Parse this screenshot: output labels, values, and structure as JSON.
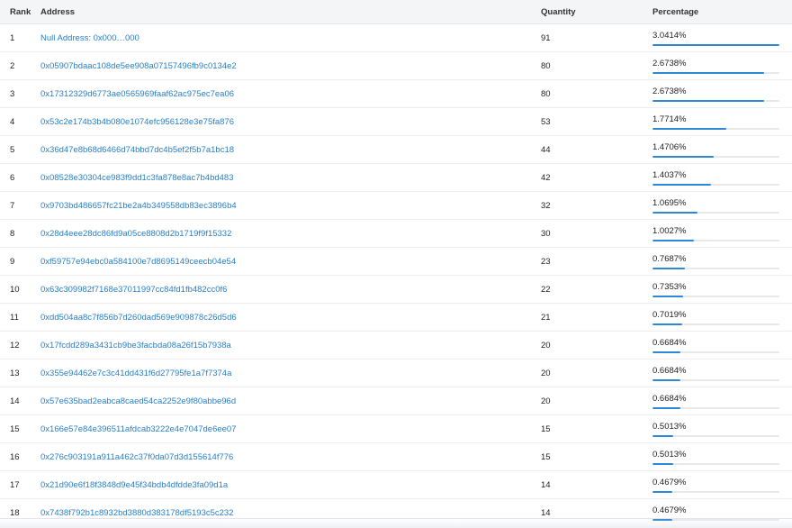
{
  "table": {
    "headers": {
      "rank": "Rank",
      "address": "Address",
      "quantity": "Quantity",
      "percentage": "Percentage"
    },
    "rows": [
      {
        "rank": "1",
        "address": "Null Address: 0x000…000",
        "quantity": "91",
        "percentage": "3.0414%",
        "percentage_value": 3.0414
      },
      {
        "rank": "2",
        "address": "0x05907bdaac108de5ee908a07157496fb9c0134e2",
        "quantity": "80",
        "percentage": "2.6738%",
        "percentage_value": 2.6738
      },
      {
        "rank": "3",
        "address": "0x17312329d6773ae0565969faaf62ac975ec7ea06",
        "quantity": "80",
        "percentage": "2.6738%",
        "percentage_value": 2.6738
      },
      {
        "rank": "4",
        "address": "0x53c2e174b3b4b080e1074efc956128e3e75fa876",
        "quantity": "53",
        "percentage": "1.7714%",
        "percentage_value": 1.7714
      },
      {
        "rank": "5",
        "address": "0x36d47e8b68d6466d74bbd7dc4b5ef2f5b7a1bc18",
        "quantity": "44",
        "percentage": "1.4706%",
        "percentage_value": 1.4706
      },
      {
        "rank": "6",
        "address": "0x08528e30304ce983f9dd1c3fa878e8ac7b4bd483",
        "quantity": "42",
        "percentage": "1.4037%",
        "percentage_value": 1.4037
      },
      {
        "rank": "7",
        "address": "0x9703bd486657fc21be2a4b349558db83ec3896b4",
        "quantity": "32",
        "percentage": "1.0695%",
        "percentage_value": 1.0695
      },
      {
        "rank": "8",
        "address": "0x28d4eee28dc86fd9a05ce8808d2b1719f9f15332",
        "quantity": "30",
        "percentage": "1.0027%",
        "percentage_value": 1.0027
      },
      {
        "rank": "9",
        "address": "0xf59757e94ebc0a584100e7d8695149ceecb04e54",
        "quantity": "23",
        "percentage": "0.7687%",
        "percentage_value": 0.7687
      },
      {
        "rank": "10",
        "address": "0x63c309982f7168e37011997cc84fd1fb482cc0f6",
        "quantity": "22",
        "percentage": "0.7353%",
        "percentage_value": 0.7353
      },
      {
        "rank": "11",
        "address": "0xdd504aa8c7f856b7d260dad569e909878c26d5d6",
        "quantity": "21",
        "percentage": "0.7019%",
        "percentage_value": 0.7019
      },
      {
        "rank": "12",
        "address": "0x17fcdd289a3431cb9be3facbda08a26f15b7938a",
        "quantity": "20",
        "percentage": "0.6684%",
        "percentage_value": 0.6684
      },
      {
        "rank": "13",
        "address": "0x355e94462e7c3c41dd431f6d27795fe1a7f7374a",
        "quantity": "20",
        "percentage": "0.6684%",
        "percentage_value": 0.6684
      },
      {
        "rank": "14",
        "address": "0x57e635bad2eabca8caed54ca2252e9f80abbe96d",
        "quantity": "20",
        "percentage": "0.6684%",
        "percentage_value": 0.6684
      },
      {
        "rank": "15",
        "address": "0x166e57e84e396511afdcab3222e4e7047de6ee07",
        "quantity": "15",
        "percentage": "0.5013%",
        "percentage_value": 0.5013
      },
      {
        "rank": "16",
        "address": "0x276c903191a911a462c37f0da07d3d155614f776",
        "quantity": "15",
        "percentage": "0.5013%",
        "percentage_value": 0.5013
      },
      {
        "rank": "17",
        "address": "0x21d90e6f18f3848d9e45f34bdb4dfdde3fa09d1a",
        "quantity": "14",
        "percentage": "0.4679%",
        "percentage_value": 0.4679
      },
      {
        "rank": "18",
        "address": "0x7438f792b1c8932bd3880d383178df5193c5c232",
        "quantity": "14",
        "percentage": "0.4679%",
        "percentage_value": 0.4679
      }
    ]
  },
  "colors": {
    "link": "#2a80c9",
    "bar_fill": "#2f88d6",
    "bar_track": "#e6e8ea",
    "header_bg": "#f4f5f7"
  }
}
